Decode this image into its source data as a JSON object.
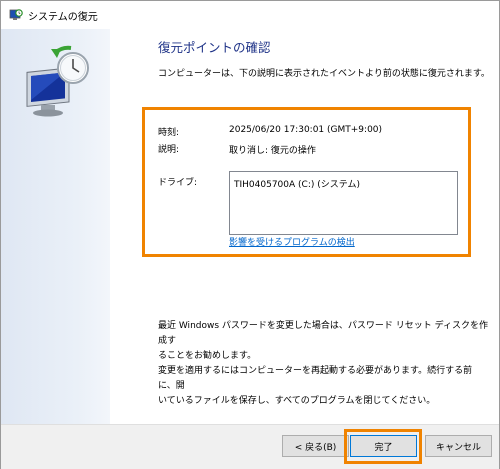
{
  "window": {
    "title": "システムの復元"
  },
  "main": {
    "heading": "復元ポイントの確認",
    "description": "コンピューターは、下の説明に表示されたイベントより前の状態に復元されます。",
    "time_label": "時刻:",
    "time_value": "2025/06/20 17:30:01 (GMT+9:00)",
    "description_label": "説明:",
    "description_value": "取り消し: 復元の操作",
    "drive_label": "ドライブ:",
    "drive_value": "TIH0405700A (C:) (システム)",
    "scan_link": "影響を受けるプログラムの検出",
    "password_note_line1": "最近 Windows パスワードを変更した場合は、パスワード リセット ディスクを作成す",
    "password_note_line2": "ることをお勧めします。",
    "restart_note_line1": "変更を適用するにはコンピューターを再起動する必要があります。続行する前に、開",
    "restart_note_line2": "いているファイルを保存し、すべてのプログラムを閉じてください。"
  },
  "buttons": {
    "back": "< 戻る(B)",
    "finish": "完了",
    "cancel": "キャンセル"
  },
  "colors": {
    "accent_highlight": "#f08300",
    "heading": "#1e3287",
    "link": "#0066cc"
  },
  "icons": {
    "title_icon": "system-restore-icon",
    "hero_icon": "system-restore-monitor-clock-icon"
  }
}
